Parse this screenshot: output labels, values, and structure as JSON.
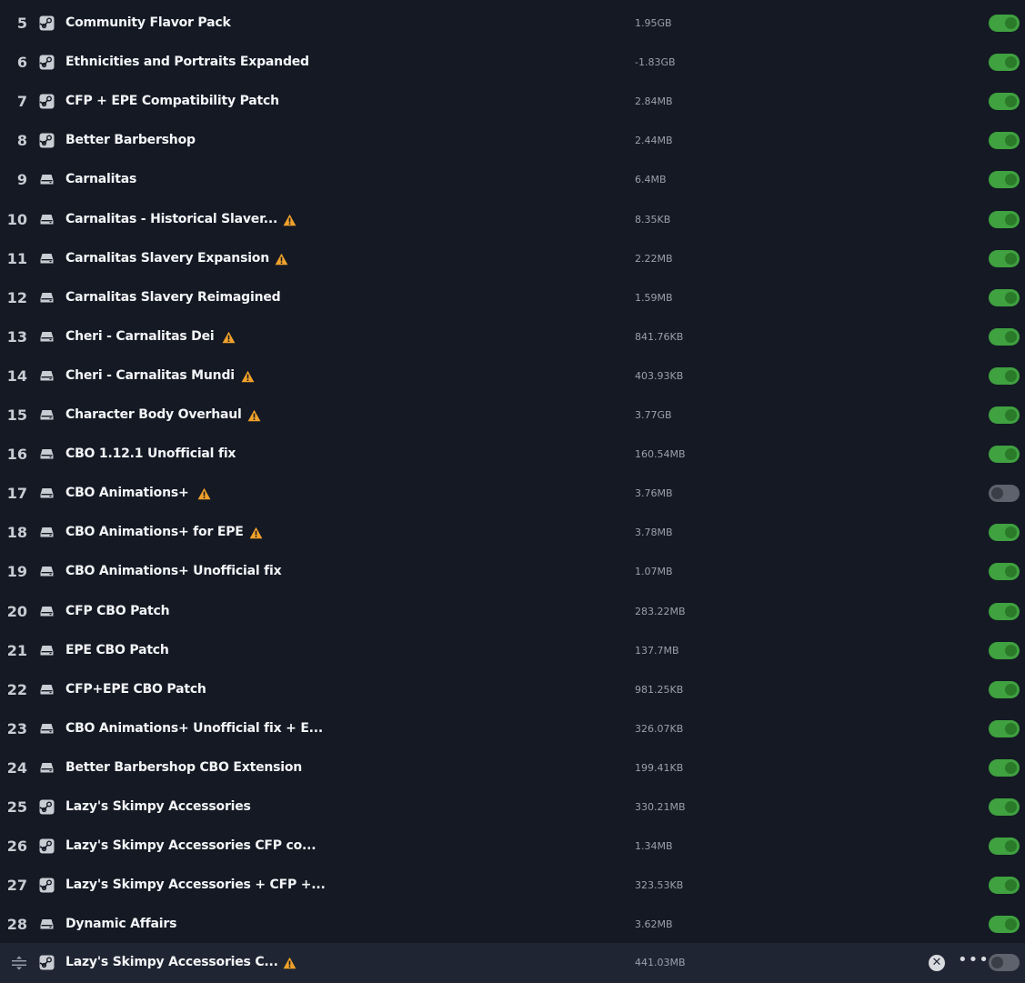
{
  "icons": {
    "steam": "steam-workshop-icon",
    "local": "local-drive-icon",
    "warning": "warning-icon",
    "drag": "drag-handle-icon",
    "remove": "remove-icon",
    "more": "more-options-icon"
  },
  "colors": {
    "background": "#141924",
    "row_hover": "#1f2532",
    "toggle_on": "#3fa13f",
    "toggle_off": "#5d626c",
    "warning": "#f0a12a"
  },
  "mods": [
    {
      "index": "5",
      "source": "steam",
      "name": "Community Flavor Pack",
      "size": "1.95GB",
      "warning": false,
      "enabled": true
    },
    {
      "index": "6",
      "source": "steam",
      "name": "Ethnicities and Portraits Expanded",
      "size": "-1.83GB",
      "warning": false,
      "enabled": true
    },
    {
      "index": "7",
      "source": "steam",
      "name": "CFP + EPE Compatibility Patch",
      "size": "2.84MB",
      "warning": false,
      "enabled": true
    },
    {
      "index": "8",
      "source": "steam",
      "name": "Better Barbershop",
      "size": "2.44MB",
      "warning": false,
      "enabled": true
    },
    {
      "index": "9",
      "source": "local",
      "name": "Carnalitas",
      "size": "6.4MB",
      "warning": false,
      "enabled": true
    },
    {
      "index": "10",
      "source": "local",
      "name": "Carnalitas - Historical Slaver...",
      "size": "8.35KB",
      "warning": true,
      "enabled": true
    },
    {
      "index": "11",
      "source": "local",
      "name": "Carnalitas Slavery Expansion",
      "size": "2.22MB",
      "warning": true,
      "enabled": true
    },
    {
      "index": "12",
      "source": "local",
      "name": "Carnalitas Slavery Reimagined",
      "size": "1.59MB",
      "warning": false,
      "enabled": true
    },
    {
      "index": "13",
      "source": "local",
      "name": "Cheri - Carnalitas Dei",
      "size": "841.76KB",
      "warning": true,
      "enabled": true
    },
    {
      "index": "14",
      "source": "local",
      "name": "Cheri - Carnalitas Mundi",
      "size": "403.93KB",
      "warning": true,
      "enabled": true
    },
    {
      "index": "15",
      "source": "local",
      "name": "Character Body Overhaul",
      "size": "3.77GB",
      "warning": true,
      "enabled": true
    },
    {
      "index": "16",
      "source": "local",
      "name": "CBO 1.12.1 Unofficial fix",
      "size": "160.54MB",
      "warning": false,
      "enabled": true
    },
    {
      "index": "17",
      "source": "local",
      "name": "CBO Animations+",
      "size": "3.76MB",
      "warning": true,
      "enabled": false
    },
    {
      "index": "18",
      "source": "local",
      "name": "CBO Animations+ for EPE",
      "size": "3.78MB",
      "warning": true,
      "enabled": true
    },
    {
      "index": "19",
      "source": "local",
      "name": "CBO Animations+ Unofficial fix",
      "size": "1.07MB",
      "warning": false,
      "enabled": true
    },
    {
      "index": "20",
      "source": "local",
      "name": "CFP CBO Patch",
      "size": "283.22MB",
      "warning": false,
      "enabled": true
    },
    {
      "index": "21",
      "source": "local",
      "name": "EPE CBO Patch",
      "size": "137.7MB",
      "warning": false,
      "enabled": true
    },
    {
      "index": "22",
      "source": "local",
      "name": "CFP+EPE CBO Patch",
      "size": "981.25KB",
      "warning": false,
      "enabled": true
    },
    {
      "index": "23",
      "source": "local",
      "name": "CBO Animations+ Unofficial fix + E...",
      "size": "326.07KB",
      "warning": false,
      "enabled": true
    },
    {
      "index": "24",
      "source": "local",
      "name": "Better Barbershop CBO Extension",
      "size": "199.41KB",
      "warning": false,
      "enabled": true
    },
    {
      "index": "25",
      "source": "steam",
      "name": "Lazy's Skimpy Accessories",
      "size": "330.21MB",
      "warning": false,
      "enabled": true
    },
    {
      "index": "26",
      "source": "steam",
      "name": "Lazy's Skimpy Accessories CFP co...",
      "size": "1.34MB",
      "warning": false,
      "enabled": true
    },
    {
      "index": "27",
      "source": "steam",
      "name": "Lazy's Skimpy Accessories + CFP +...",
      "size": "323.53KB",
      "warning": false,
      "enabled": true
    },
    {
      "index": "28",
      "source": "local",
      "name": "Dynamic Affairs",
      "size": "3.62MB",
      "warning": false,
      "enabled": true
    },
    {
      "index": "",
      "source": "steam",
      "name": "Lazy's Skimpy Accessories C...",
      "size": "441.03MB",
      "warning": true,
      "enabled": false,
      "hovered": true
    }
  ]
}
